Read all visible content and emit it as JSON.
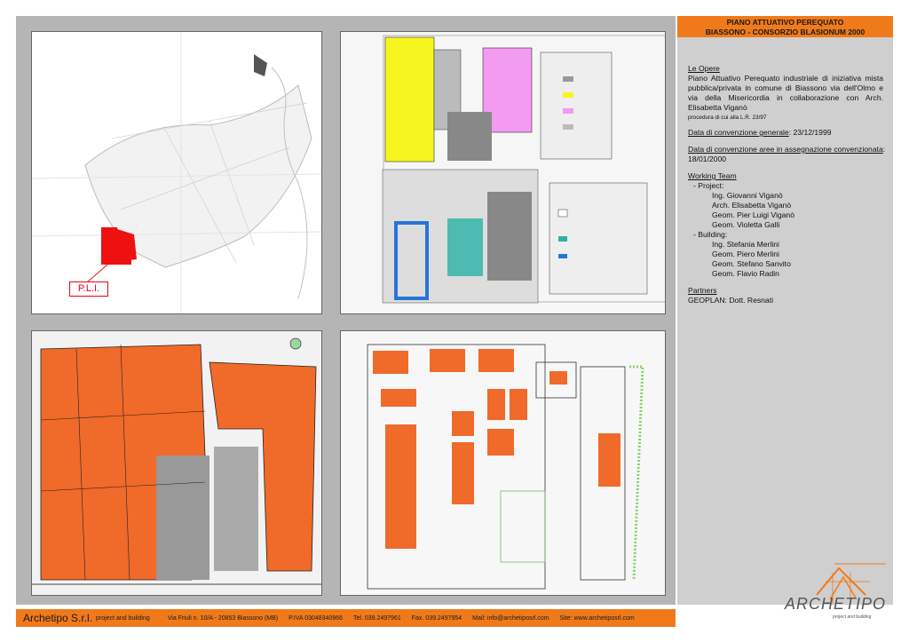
{
  "header": {
    "title_line1": "PIANO ATTUATIVO PEREQUATO",
    "title_line2": "BIASSONO - CONSORZIO BLASIONUM 2000"
  },
  "maps": {
    "location_label": "P.L.I."
  },
  "info": {
    "opere_title": "Le Opere",
    "opere_text": "Piano Attuativo Perequato industriale di iniziativa mista pubblica/privata in comune di Biassono via dell'Olmo e via della Misericordia in collaborazione con Arch. Elisabetta Viganò",
    "opere_note": "procedura di cui alla L.R. 23/97",
    "conv_gen_label": "Data di convenzione generale",
    "conv_gen_date": ": 23/12/1999",
    "conv_aree_label": "Data di convenzione aree in assegnazione convenzionata",
    "conv_aree_date": ": 18/01/2000",
    "team_title": "Working Team",
    "project_label": "- Project:",
    "project_members": [
      "Ing. Giovanni Viganò",
      "Arch. Elisabetta Viganò",
      "Geom. Pier Luigi Viganò",
      "Geom. Violetta Galli"
    ],
    "building_label": "- Building:",
    "building_members": [
      "Ing. Stefania Merlini",
      "Geom. Piero Merlini",
      "Geom. Stefano Sanvito",
      "Geom. Flavio Radin"
    ],
    "partners_title": "Partners",
    "partners_text": "GEOPLAN: Dott. Resnati"
  },
  "footer": {
    "company": "Archetipo S.r.l.",
    "tagline": "project and building",
    "address": "Via Friuli n. 10/A - 20853 Biassono (MB)",
    "piva": "P.IVA 03048340966",
    "tel": "Tel. 039.2497961",
    "fax": "Fax. 039.2497954",
    "mail": "Mail: info@archetiposrl.com",
    "site": "Site: www.archetiposrl.com"
  },
  "logo": {
    "text": "ARCHETIPO",
    "sub": "project and building"
  },
  "colors": {
    "accent": "#f07a1a",
    "map_orange": "#f06a2a",
    "panel_grey": "#b5b5b5",
    "info_grey": "#cfcfcf"
  }
}
